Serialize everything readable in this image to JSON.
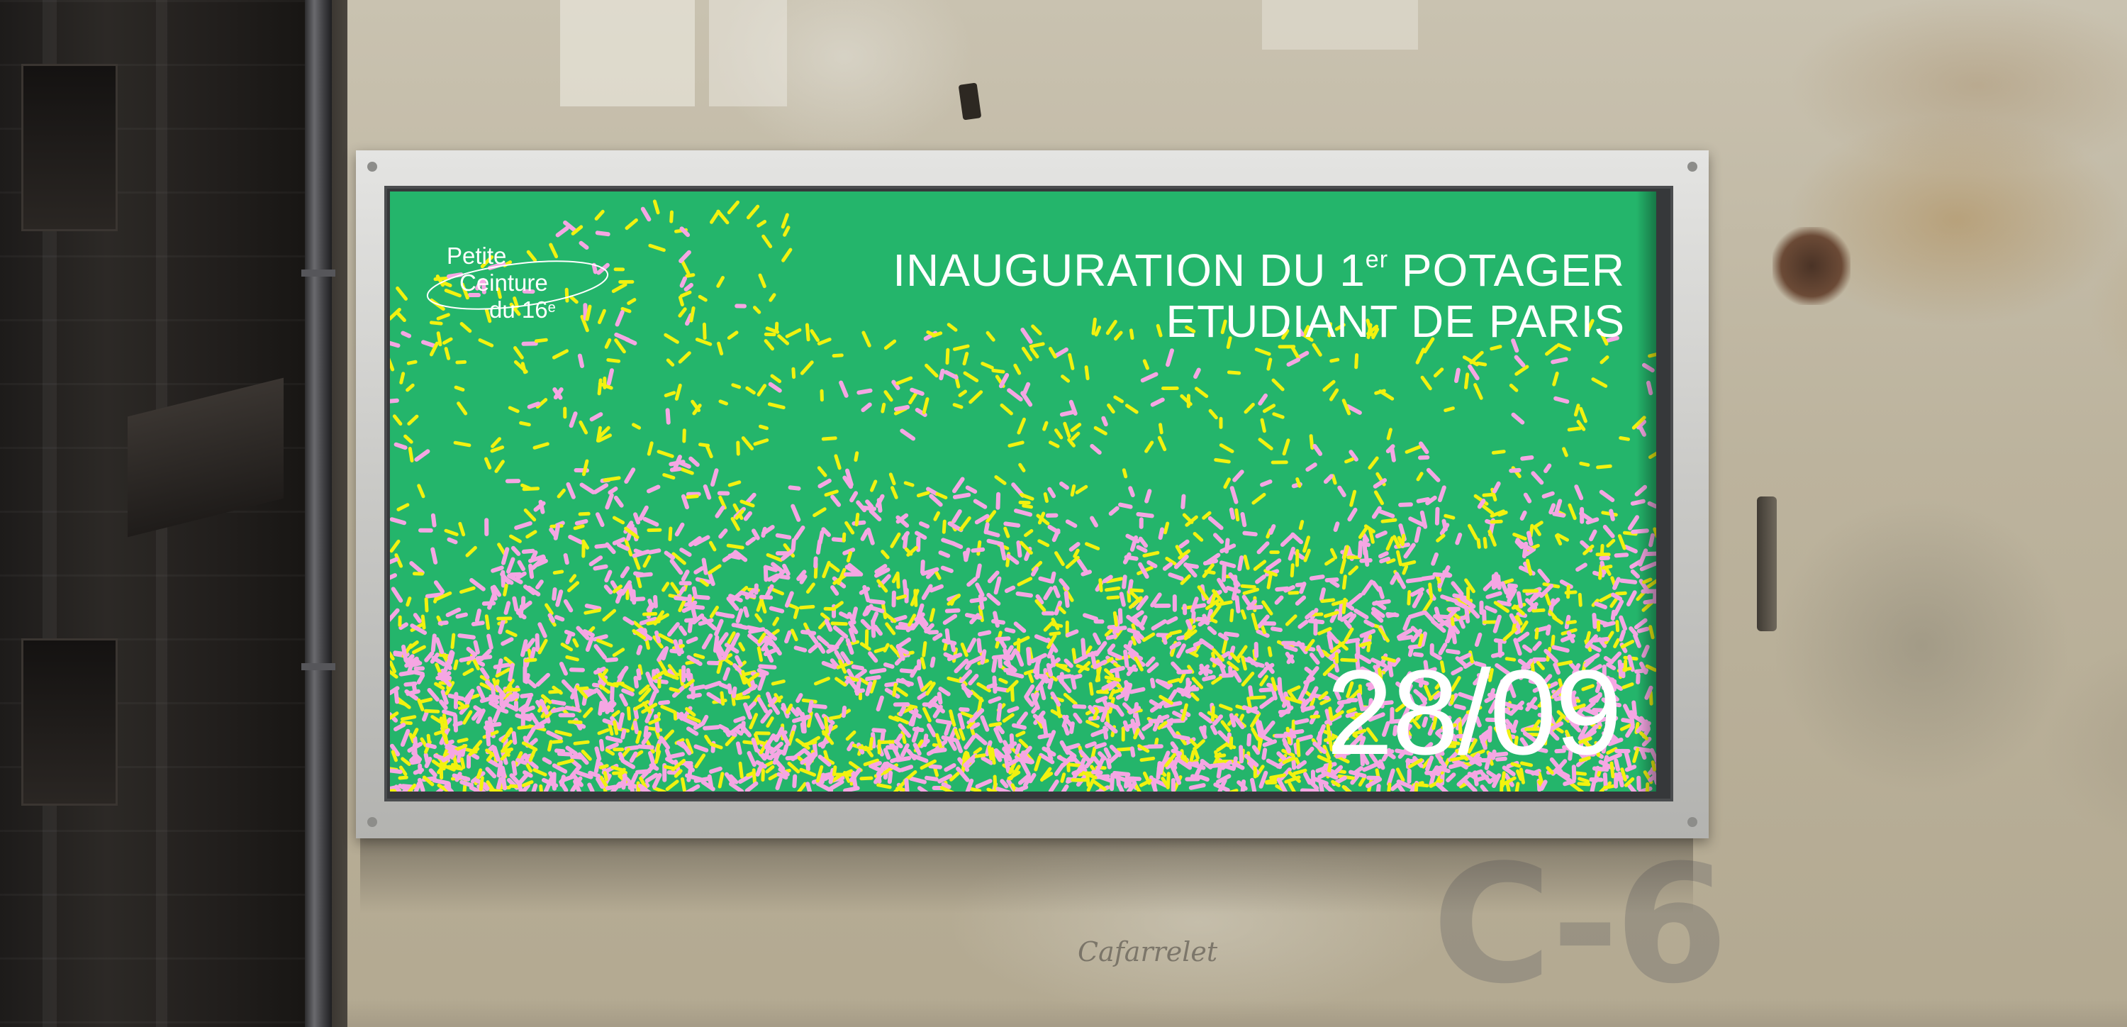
{
  "scene": {
    "description_type": "billboard-mockup",
    "colors": {
      "poster_background": "#24b56b",
      "sprinkle_pink": "#f5a6e3",
      "sprinkle_yellow": "#f2f20f",
      "text": "#ffffff",
      "frame": "#c9c9c6",
      "wall": "#bcb39d",
      "building": "#221f1d"
    }
  },
  "poster": {
    "logo": {
      "line1": "Petite",
      "line2": "Ceinture",
      "line3": "du 16",
      "line3_sup": "e"
    },
    "headline": {
      "line1_a": "INAUGURATION DU 1",
      "line1_sup": "er",
      "line1_b": " POTAGER",
      "line2": "ETUDIANT DE PARIS"
    },
    "date": "28/09"
  },
  "wall": {
    "ghost_letters": "C-6",
    "scrawl": "Cafarrelet"
  }
}
